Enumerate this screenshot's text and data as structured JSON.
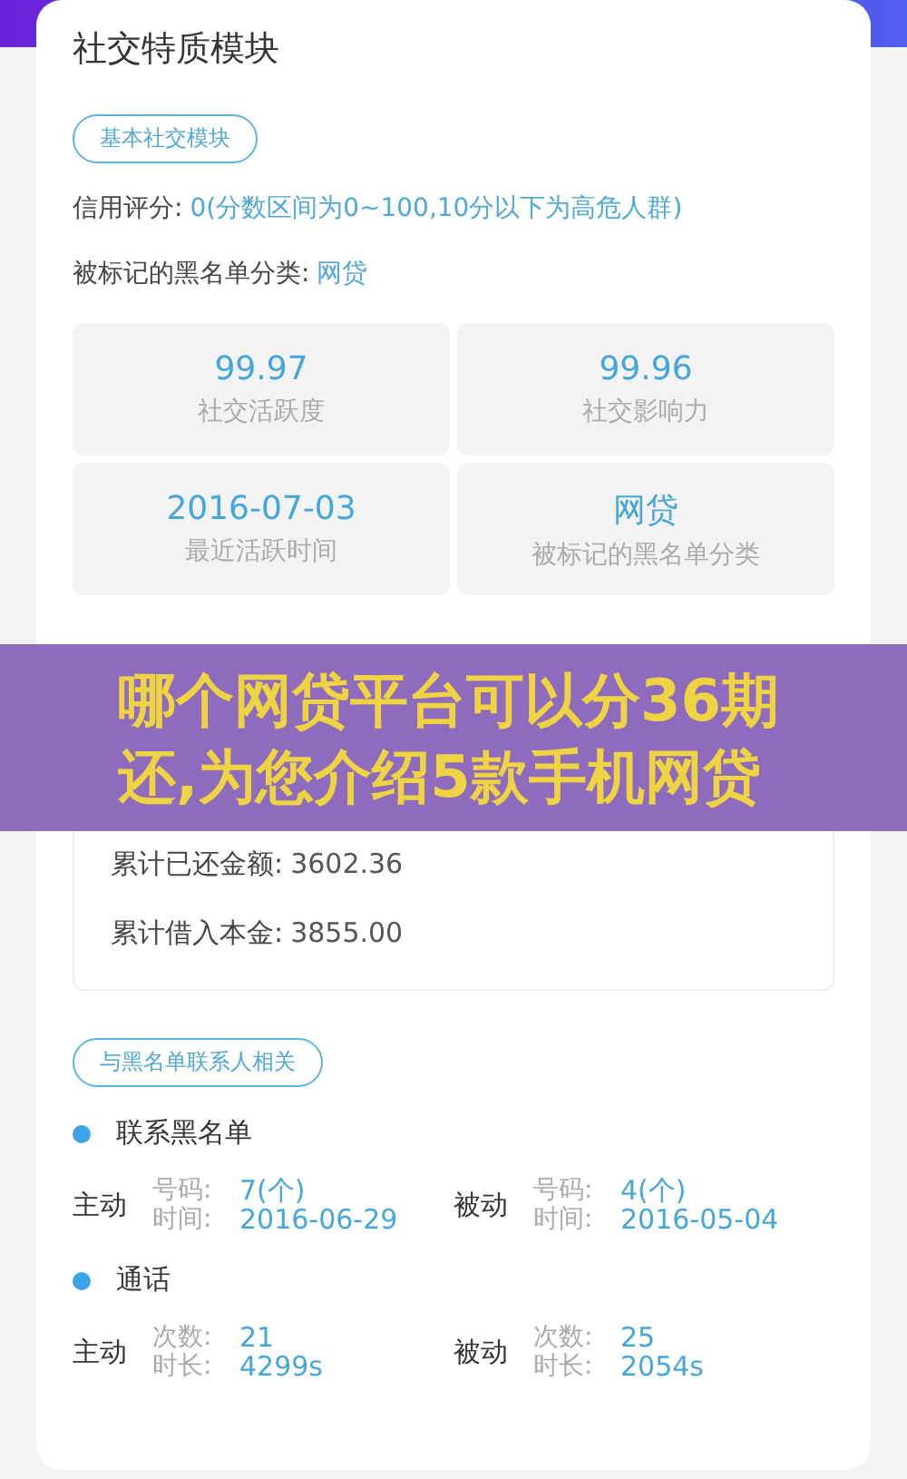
{
  "card": {
    "title": "社交特质模块",
    "basic_tag": "基本社交模块",
    "fields": [
      {
        "label": "信用评分:",
        "value": "0(分数区间为0~100,10分以下为高危人群)"
      },
      {
        "label": "被标记的黑名单分类:",
        "value": "网贷"
      }
    ],
    "stats": [
      {
        "value": "99.97",
        "label": "社交活跃度"
      },
      {
        "value": "99.96",
        "label": "社交影响力"
      },
      {
        "value": "2016-07-03",
        "label": "最近活跃时间"
      },
      {
        "value": "网贷",
        "label": "被标记的黑名单分类"
      }
    ],
    "details": [
      {
        "label": "累计已还金额:",
        "value": "3602.36"
      },
      {
        "label": "累计借入本金:",
        "value": "3855.00"
      }
    ],
    "contact_tag": "与黑名单联系人相关",
    "groups": [
      {
        "heading": "联系黑名单",
        "sides": [
          {
            "side": "主动",
            "rows": [
              {
                "label": "号码:",
                "value": "7(个)"
              },
              {
                "label": "时间:",
                "value": "2016-06-29"
              }
            ]
          },
          {
            "side": "被动",
            "rows": [
              {
                "label": "号码:",
                "value": "4(个)"
              },
              {
                "label": "时间:",
                "value": "2016-05-04"
              }
            ]
          }
        ]
      },
      {
        "heading": "通话",
        "sides": [
          {
            "side": "主动",
            "rows": [
              {
                "label": "次数:",
                "value": "21"
              },
              {
                "label": "时长:",
                "value": "4299s"
              }
            ]
          },
          {
            "side": "被动",
            "rows": [
              {
                "label": "次数:",
                "value": "25"
              },
              {
                "label": "时长:",
                "value": "2054s"
              }
            ]
          }
        ]
      }
    ]
  },
  "banner": {
    "text": "哪个网贷平台可以分36期还,为您介绍5款手机网贷"
  }
}
